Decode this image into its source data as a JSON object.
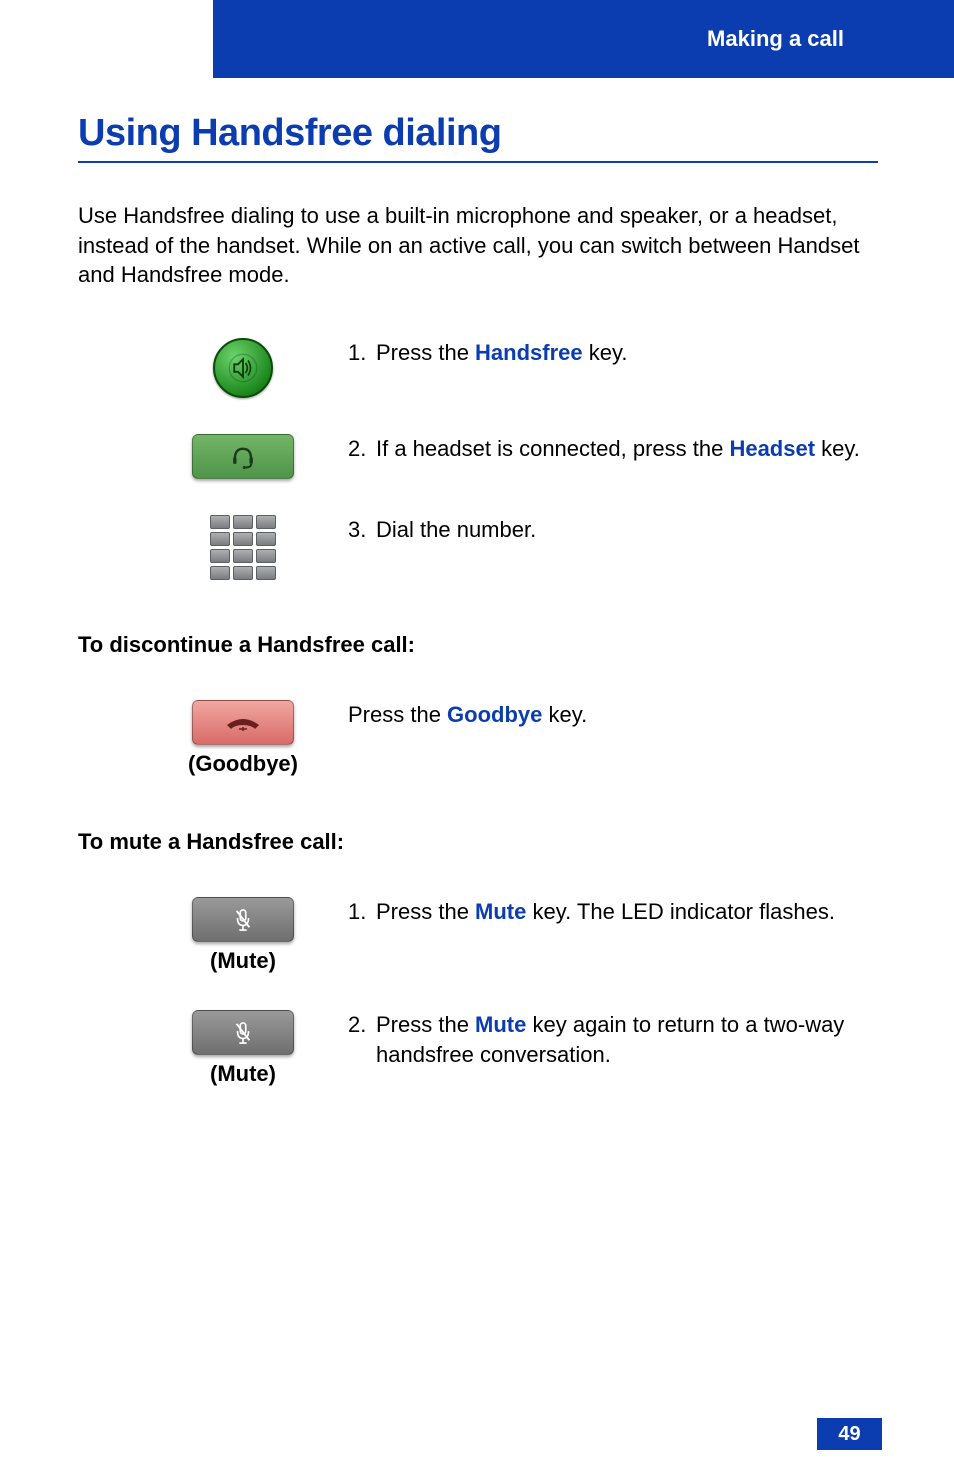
{
  "header": {
    "section": "Making a call"
  },
  "title": "Using Handsfree dialing",
  "intro": "Use Handsfree dialing to use a built-in microphone and speaker, or a headset, instead of the handset. While on an active call, you can switch between Handset and Handsfree mode.",
  "steps": [
    {
      "num": "1.",
      "pre": "Press the ",
      "key": "Handsfree",
      "post": " key."
    },
    {
      "num": "2.",
      "pre": "If a headset is connected, press the ",
      "key": "Headset",
      "post": " key."
    },
    {
      "num": "3.",
      "pre": "Dial the number.",
      "key": "",
      "post": ""
    }
  ],
  "discontinue": {
    "heading": "To discontinue a Handsfree call:",
    "caption": "(Goodbye)",
    "text_pre": "Press the ",
    "text_key": "Goodbye",
    "text_post": " key."
  },
  "mute": {
    "heading": "To mute a Handsfree call:",
    "caption": "(Mute)",
    "steps": [
      {
        "num": "1.",
        "pre": "Press the ",
        "key": "Mute",
        "post": " key. The LED indicator flashes."
      },
      {
        "num": "2.",
        "pre": "Press the ",
        "key": "Mute",
        "post": " key again to return to a two-way handsfree conversation."
      }
    ]
  },
  "page_number": "49"
}
